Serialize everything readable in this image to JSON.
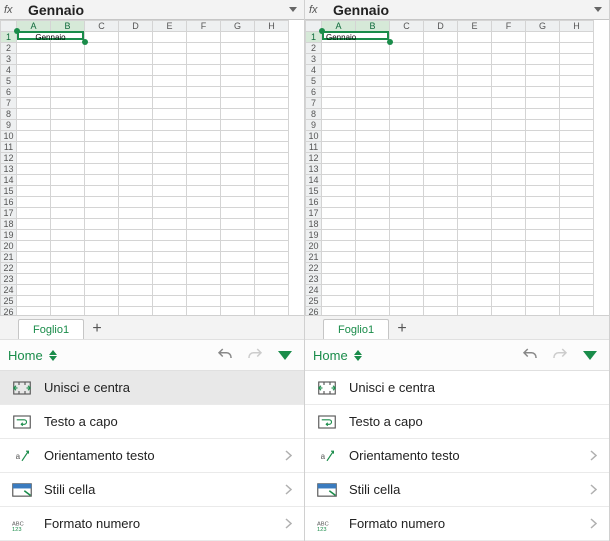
{
  "left": {
    "formula": {
      "fx": "fx",
      "value": "Gennaio"
    },
    "columns": [
      "A",
      "B",
      "C",
      "D",
      "E",
      "F",
      "G",
      "H"
    ],
    "rows_visible": 27,
    "cell_a1_merged_text": "Gennaio",
    "sheet_tab": "Foglio1",
    "add_tab": "+",
    "toolbar": {
      "home": "Home"
    },
    "menu": [
      {
        "id": "merge",
        "label": "Unisci e centra",
        "highlight": true
      },
      {
        "id": "wrap",
        "label": "Testo a capo"
      },
      {
        "id": "orient",
        "label": "Orientamento testo",
        "chevron": true
      },
      {
        "id": "styles",
        "label": "Stili cella",
        "chevron": true
      },
      {
        "id": "numfmt",
        "label": "Formato numero",
        "chevron": true
      }
    ]
  },
  "right": {
    "formula": {
      "fx": "fx",
      "value": "Gennaio"
    },
    "columns": [
      "A",
      "B",
      "C",
      "D",
      "E",
      "F",
      "G",
      "H"
    ],
    "rows_visible": 27,
    "cell_a1_text": "Gennaio",
    "sheet_tab": "Foglio1",
    "add_tab": "+",
    "toolbar": {
      "home": "Home"
    },
    "menu": [
      {
        "id": "merge",
        "label": "Unisci e centra"
      },
      {
        "id": "wrap",
        "label": "Testo a capo"
      },
      {
        "id": "orient",
        "label": "Orientamento testo",
        "chevron": true
      },
      {
        "id": "styles",
        "label": "Stili cella",
        "chevron": true
      },
      {
        "id": "numfmt",
        "label": "Formato numero",
        "chevron": true
      }
    ]
  },
  "icons": {
    "merge": "merge-cells-icon",
    "wrap": "wrap-text-icon",
    "orient": "text-orientation-icon",
    "styles": "cell-styles-icon",
    "numfmt": "number-format-icon",
    "undo": "undo-icon",
    "redo": "redo-icon",
    "dropdown": "chevron-down-icon",
    "expand": "expand-icon"
  }
}
